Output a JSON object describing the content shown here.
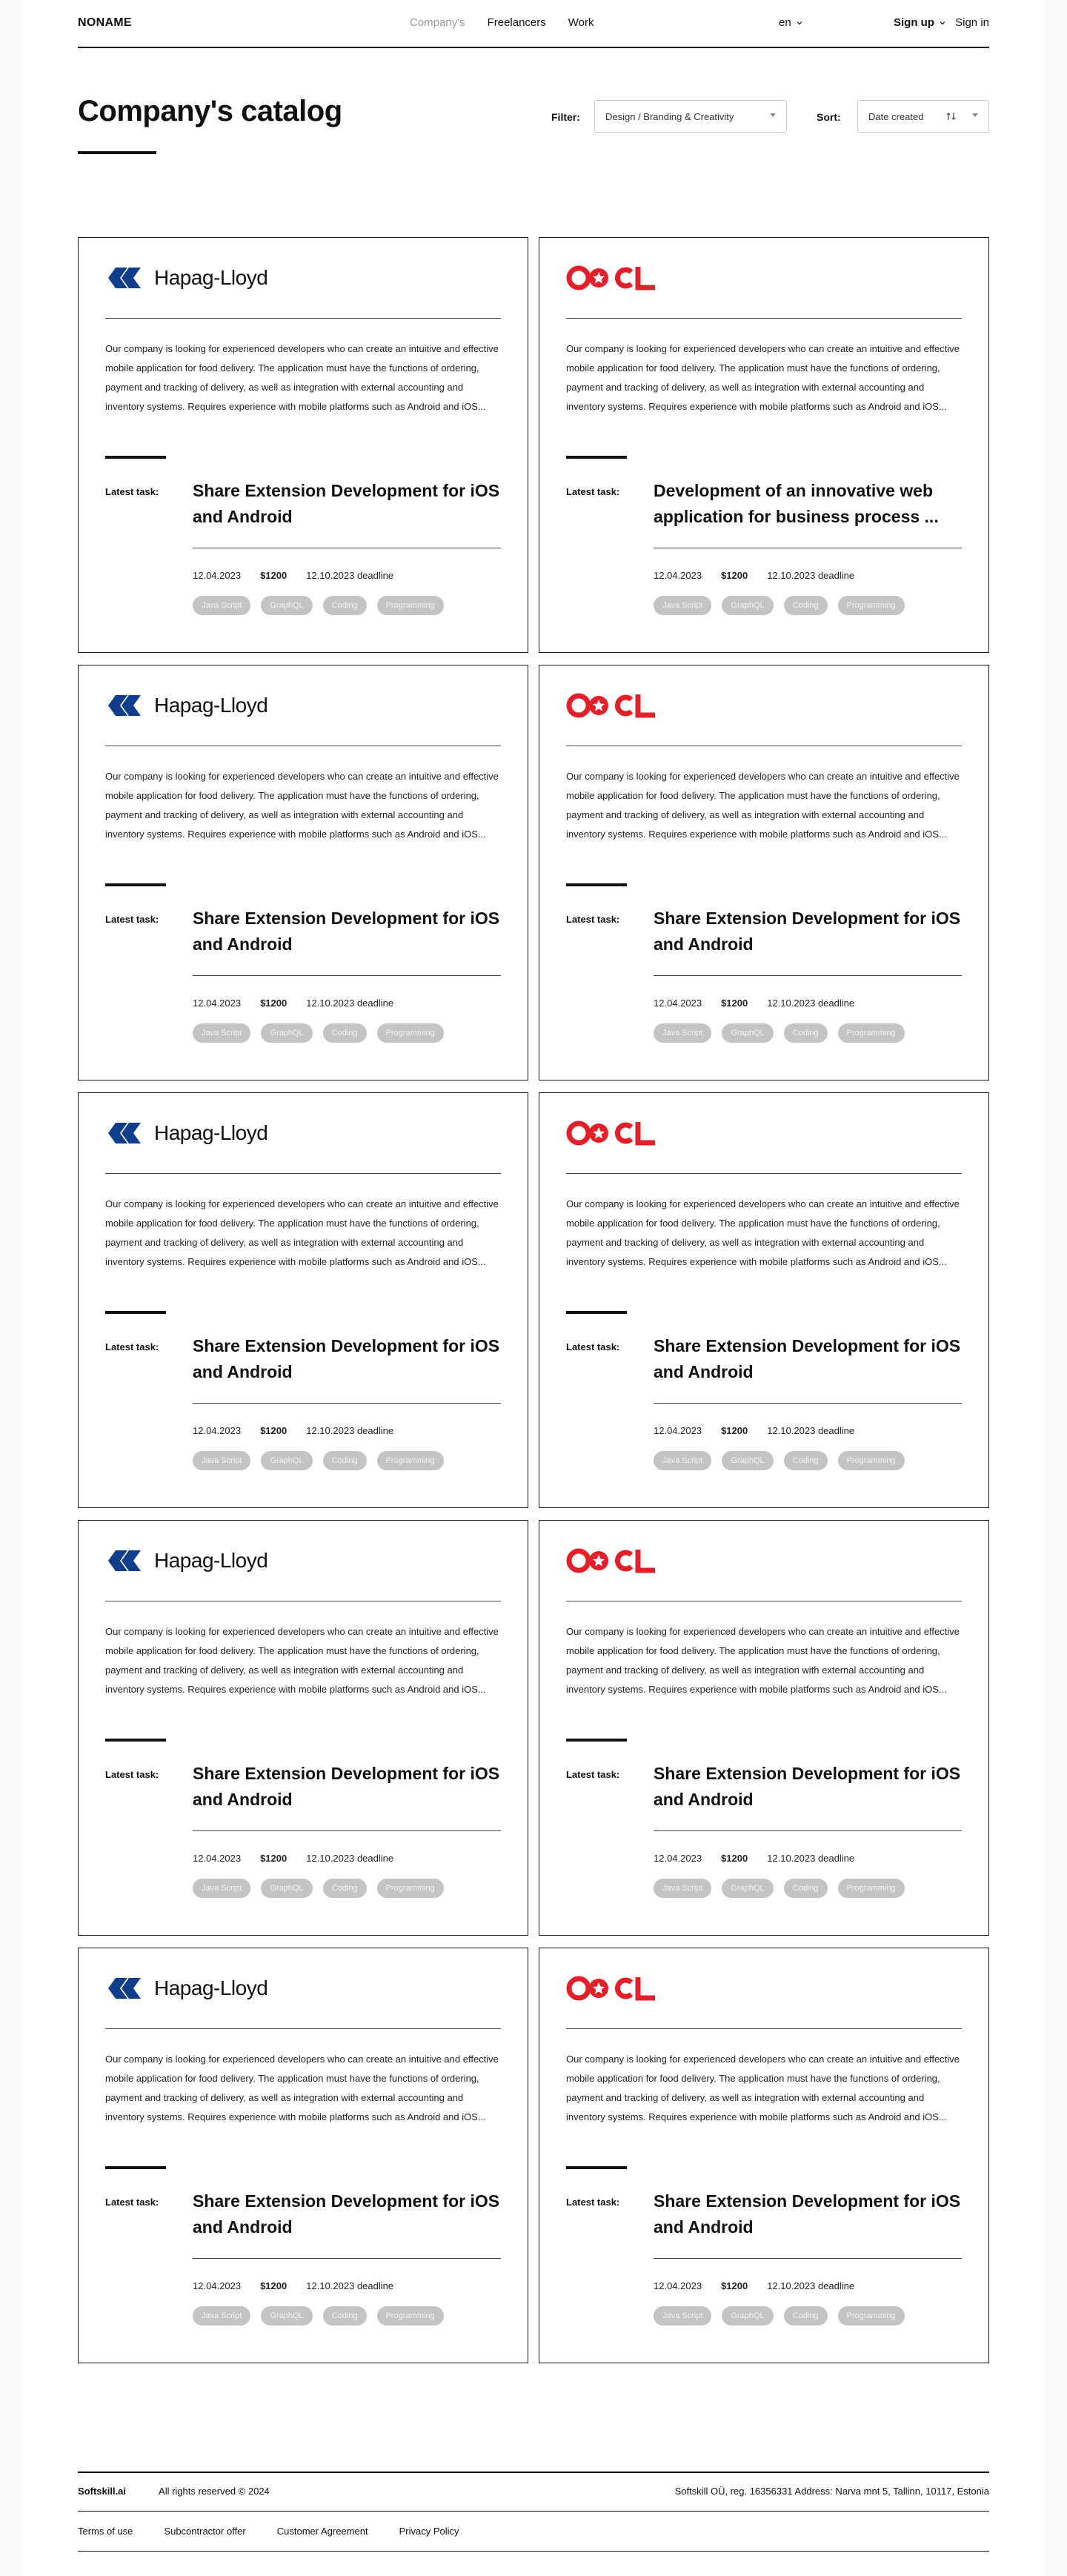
{
  "header": {
    "logo": "NONAME",
    "nav": [
      {
        "label": "Company's",
        "muted": true
      },
      {
        "label": "Freelancers",
        "muted": false
      },
      {
        "label": "Work",
        "muted": false
      }
    ],
    "language": "en",
    "sign_up": "Sign up",
    "sign_in": "Sign in"
  },
  "catalog": {
    "title": "Company's catalog",
    "filter_label": "Filter:",
    "filter_value": "Design / Branding & Creativity",
    "sort_label": "Sort:",
    "sort_value": "Date created"
  },
  "cards": [
    {
      "company": "Hapag-Lloyd",
      "description": "Our company is looking for experienced developers who can create an intuitive and effective mobile application for food delivery. The application must have the functions of ordering, payment and tracking of delivery, as well as integration with external accounting and inventory systems. Requires experience with mobile platforms such as Android and iOS...",
      "latest_label": "Latest task:",
      "task_title": "Share Extension Development for iOS and Android",
      "date": "12.04.2023",
      "price": "$1200",
      "deadline": "12.10.2023",
      "deadline_label": "deadline",
      "tags": [
        "Java Script",
        "GraphQL",
        "Coding",
        "Programming"
      ]
    },
    {
      "company": "OOCL",
      "description": "Our company is looking for experienced developers who can create an intuitive and effective mobile application for food delivery. The application must have the functions of ordering, payment and tracking of delivery, as well as integration with external accounting and inventory systems. Requires experience with mobile platforms such as Android and iOS...",
      "latest_label": "Latest task:",
      "task_title": "Development of an innovative web application for business process ...",
      "date": "12.04.2023",
      "price": "$1200",
      "deadline": "12.10.2023",
      "deadline_label": "deadline",
      "tags": [
        "Java Script",
        "GraphQL",
        "Coding",
        "Programming"
      ]
    },
    {
      "company": "Hapag-Lloyd",
      "description": "Our company is looking for experienced developers who can create an intuitive and effective mobile application for food delivery. The application must have the functions of ordering, payment and tracking of delivery, as well as integration with external accounting and inventory systems. Requires experience with mobile platforms such as Android and iOS...",
      "latest_label": "Latest task:",
      "task_title": "Share Extension Development for iOS and Android",
      "date": "12.04.2023",
      "price": "$1200",
      "deadline": "12.10.2023",
      "deadline_label": "deadline",
      "tags": [
        "Java Script",
        "GraphQL",
        "Coding",
        "Programming"
      ]
    },
    {
      "company": "OOCL",
      "description": "Our company is looking for experienced developers who can create an intuitive and effective mobile application for food delivery. The application must have the functions of ordering, payment and tracking of delivery, as well as integration with external accounting and inventory systems. Requires experience with mobile platforms such as Android and iOS...",
      "latest_label": "Latest task:",
      "task_title": "Share Extension Development for iOS and Android",
      "date": "12.04.2023",
      "price": "$1200",
      "deadline": "12.10.2023",
      "deadline_label": "deadline",
      "tags": [
        "Java Script",
        "GraphQL",
        "Coding",
        "Programming"
      ]
    },
    {
      "company": "Hapag-Lloyd",
      "description": "Our company is looking for experienced developers who can create an intuitive and effective mobile application for food delivery. The application must have the functions of ordering, payment and tracking of delivery, as well as integration with external accounting and inventory systems. Requires experience with mobile platforms such as Android and iOS...",
      "latest_label": "Latest task:",
      "task_title": "Share Extension Development for iOS and Android",
      "date": "12.04.2023",
      "price": "$1200",
      "deadline": "12.10.2023",
      "deadline_label": "deadline",
      "tags": [
        "Java Script",
        "GraphQL",
        "Coding",
        "Programming"
      ]
    },
    {
      "company": "OOCL",
      "description": "Our company is looking for experienced developers who can create an intuitive and effective mobile application for food delivery. The application must have the functions of ordering, payment and tracking of delivery, as well as integration with external accounting and inventory systems. Requires experience with mobile platforms such as Android and iOS...",
      "latest_label": "Latest task:",
      "task_title": "Share Extension Development for iOS and Android",
      "date": "12.04.2023",
      "price": "$1200",
      "deadline": "12.10.2023",
      "deadline_label": "deadline",
      "tags": [
        "Java Script",
        "GraphQL",
        "Coding",
        "Programming"
      ]
    },
    {
      "company": "Hapag-Lloyd",
      "description": "Our company is looking for experienced developers who can create an intuitive and effective mobile application for food delivery. The application must have the functions of ordering, payment and tracking of delivery, as well as integration with external accounting and inventory systems. Requires experience with mobile platforms such as Android and iOS...",
      "latest_label": "Latest task:",
      "task_title": "Share Extension Development for iOS and Android",
      "date": "12.04.2023",
      "price": "$1200",
      "deadline": "12.10.2023",
      "deadline_label": "deadline",
      "tags": [
        "Java Script",
        "GraphQL",
        "Coding",
        "Programming"
      ]
    },
    {
      "company": "OOCL",
      "description": "Our company is looking for experienced developers who can create an intuitive and effective mobile application for food delivery. The application must have the functions of ordering, payment and tracking of delivery, as well as integration with external accounting and inventory systems. Requires experience with mobile platforms such as Android and iOS...",
      "latest_label": "Latest task:",
      "task_title": "Share Extension Development for iOS and Android",
      "date": "12.04.2023",
      "price": "$1200",
      "deadline": "12.10.2023",
      "deadline_label": "deadline",
      "tags": [
        "Java Script",
        "GraphQL",
        "Coding",
        "Programming"
      ]
    },
    {
      "company": "Hapag-Lloyd",
      "description": "Our company is looking for experienced developers who can create an intuitive and effective mobile application for food delivery. The application must have the functions of ordering, payment and tracking of delivery, as well as integration with external accounting and inventory systems. Requires experience with mobile platforms such as Android and iOS...",
      "latest_label": "Latest task:",
      "task_title": "Share Extension Development for iOS and Android",
      "date": "12.04.2023",
      "price": "$1200",
      "deadline": "12.10.2023",
      "deadline_label": "deadline",
      "tags": [
        "Java Script",
        "GraphQL",
        "Coding",
        "Programming"
      ]
    },
    {
      "company": "OOCL",
      "description": "Our company is looking for experienced developers who can create an intuitive and effective mobile application for food delivery. The application must have the functions of ordering, payment and tracking of delivery, as well as integration with external accounting and inventory systems. Requires experience with mobile platforms such as Android and iOS...",
      "latest_label": "Latest task:",
      "task_title": "Share Extension Development for iOS and Android",
      "date": "12.04.2023",
      "price": "$1200",
      "deadline": "12.10.2023",
      "deadline_label": "deadline",
      "tags": [
        "Java Script",
        "GraphQL",
        "Coding",
        "Programming"
      ]
    }
  ],
  "footer": {
    "brand": "Softskill.ai",
    "rights": "All rights reserved © 2024",
    "address": "Softskill OÜ, reg. 16356331 Address: Narva mnt 5, Tallinn, 10117, Estonia",
    "links": [
      "Terms of use",
      "Subcontractor offer",
      "Customer Agreement",
      "Privacy Policy"
    ]
  },
  "colors": {
    "hapag_blue": "#0f3e8c",
    "oocl_red": "#e3202a",
    "tag_bg": "#c4c4c4",
    "muted_text": "#9a9a9a"
  }
}
